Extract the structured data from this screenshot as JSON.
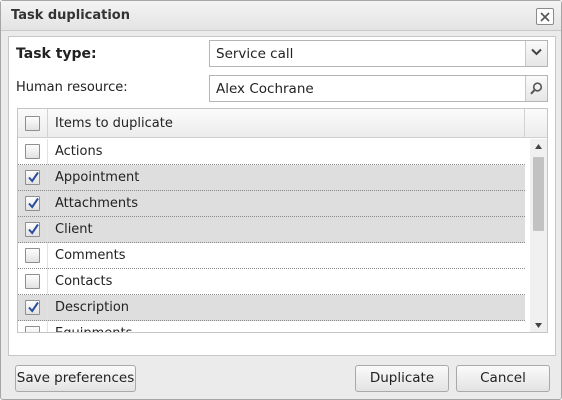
{
  "dialog": {
    "title": "Task duplication"
  },
  "form": {
    "task_type_label": "Task type:",
    "task_type_value": "Service call",
    "human_resource_label": "Human resource:",
    "human_resource_value": "Alex Cochrane"
  },
  "grid": {
    "header_label": "Items to duplicate",
    "header_checked": false,
    "items": [
      {
        "label": "Actions",
        "checked": false
      },
      {
        "label": "Appointment",
        "checked": true
      },
      {
        "label": "Attachments",
        "checked": true
      },
      {
        "label": "Client",
        "checked": true
      },
      {
        "label": "Comments",
        "checked": false
      },
      {
        "label": "Contacts",
        "checked": false
      },
      {
        "label": "Description",
        "checked": true
      },
      {
        "label": "Equipments",
        "checked": false
      }
    ]
  },
  "footer": {
    "save_label": "Save preferences",
    "duplicate_label": "Duplicate",
    "cancel_label": "Cancel"
  },
  "icons": {
    "close": "close-icon",
    "dropdown": "chevron-down-icon",
    "search": "search-icon",
    "check": "check-icon"
  }
}
